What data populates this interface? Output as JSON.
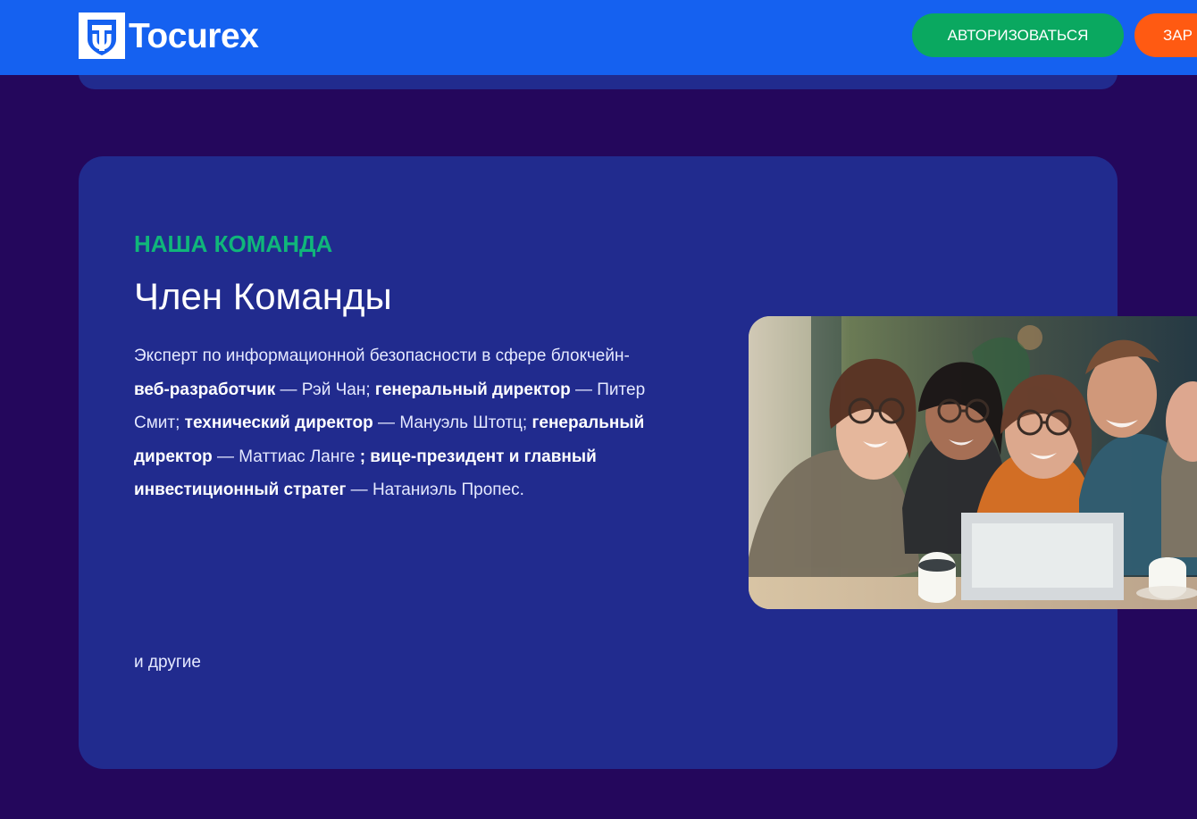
{
  "header": {
    "brand": "Tocurex",
    "login_label": "АВТОРИЗОВАТЬСЯ",
    "register_label": "ЗАР"
  },
  "team": {
    "eyebrow": "НАША КОМАНДА",
    "title": "Член Команды",
    "description": {
      "line1": "Эксперт по информационной безопасности в сфере блокчейн-",
      "role1": "веб-разработчик",
      "person1": " — Рэй Чан; ",
      "role2": "генеральный директор",
      "person2": " — Питер Смит; ",
      "role3": "технический директор",
      "person3": " — Мануэль Штотц; ",
      "role4": "генеральный директор",
      "person4": " — Маттиас Ланге ",
      "role5": "; вице-президент и главный инвестиционный стратег",
      "person5": " —  Натаниэль Пропес."
    },
    "footer": "и другие"
  },
  "colors": {
    "background": "#24075c",
    "header": "#1561f0",
    "card": "#212b8e",
    "accent_green": "#10b67a",
    "button_green": "#0aa860",
    "button_orange": "#ff5a12"
  },
  "icons": {
    "logo": "shield-logo-icon"
  }
}
